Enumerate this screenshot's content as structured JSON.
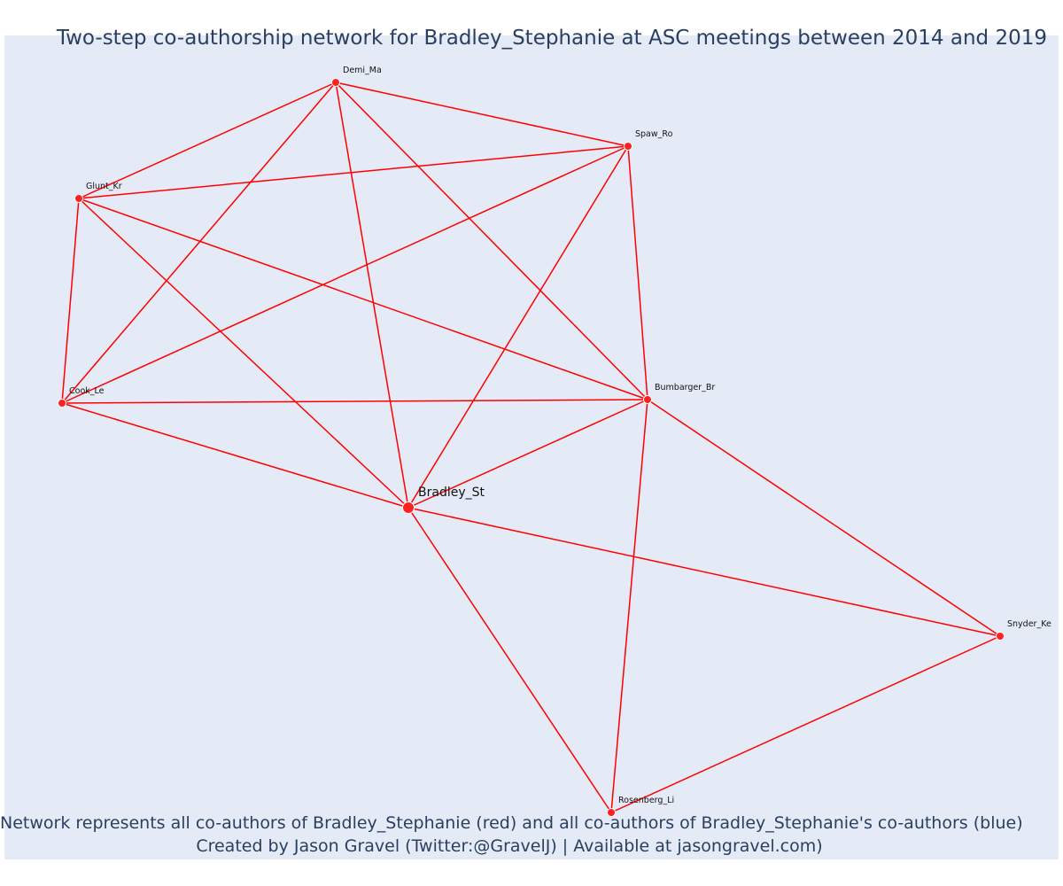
{
  "title": "Two-step co-authorship network for Bradley_Stephanie at ASC meetings between 2014 and 2019",
  "captions": {
    "line1": "Network represents all co-authors of Bradley_Stephanie (red) and all co-authors of Bradley_Stephanie's co-authors (blue)",
    "line2": "Created by Jason Gravel (Twitter:@GravelJ) | Available at jasongravel.com)"
  },
  "colors": {
    "edge": "#ff0000",
    "node": "#ff2020",
    "background": "#e5ebf6",
    "text": "#2a3f5f"
  },
  "network": {
    "nodes": [
      {
        "id": "Demi_Ma",
        "label": "Demi_Ma",
        "focal": false
      },
      {
        "id": "Spaw_Ro",
        "label": "Spaw_Ro",
        "focal": false
      },
      {
        "id": "Glunt_Kr",
        "label": "Glunt_Kr",
        "focal": false
      },
      {
        "id": "Cook_Le",
        "label": "Cook_Le",
        "focal": false
      },
      {
        "id": "Bumbarger_Br",
        "label": "Bumbarger_Br",
        "focal": false
      },
      {
        "id": "Bradley_St",
        "label": "Bradley_St",
        "focal": true
      },
      {
        "id": "Snyder_Ke",
        "label": "Snyder_Ke",
        "focal": false
      },
      {
        "id": "Rosenberg_Li",
        "label": "Rosenberg_Li",
        "focal": false
      }
    ],
    "edges": [
      [
        "Demi_Ma",
        "Spaw_Ro"
      ],
      [
        "Demi_Ma",
        "Glunt_Kr"
      ],
      [
        "Demi_Ma",
        "Cook_Le"
      ],
      [
        "Demi_Ma",
        "Bradley_St"
      ],
      [
        "Demi_Ma",
        "Bumbarger_Br"
      ],
      [
        "Spaw_Ro",
        "Glunt_Kr"
      ],
      [
        "Spaw_Ro",
        "Cook_Le"
      ],
      [
        "Spaw_Ro",
        "Bradley_St"
      ],
      [
        "Spaw_Ro",
        "Bumbarger_Br"
      ],
      [
        "Glunt_Kr",
        "Cook_Le"
      ],
      [
        "Glunt_Kr",
        "Bradley_St"
      ],
      [
        "Glunt_Kr",
        "Bumbarger_Br"
      ],
      [
        "Cook_Le",
        "Bumbarger_Br"
      ],
      [
        "Cook_Le",
        "Bradley_St"
      ],
      [
        "Bumbarger_Br",
        "Bradley_St"
      ],
      [
        "Bumbarger_Br",
        "Snyder_Ke"
      ],
      [
        "Bumbarger_Br",
        "Rosenberg_Li"
      ],
      [
        "Bradley_St",
        "Snyder_Ke"
      ],
      [
        "Bradley_St",
        "Rosenberg_Li"
      ],
      [
        "Snyder_Ke",
        "Rosenberg_Li"
      ]
    ]
  }
}
